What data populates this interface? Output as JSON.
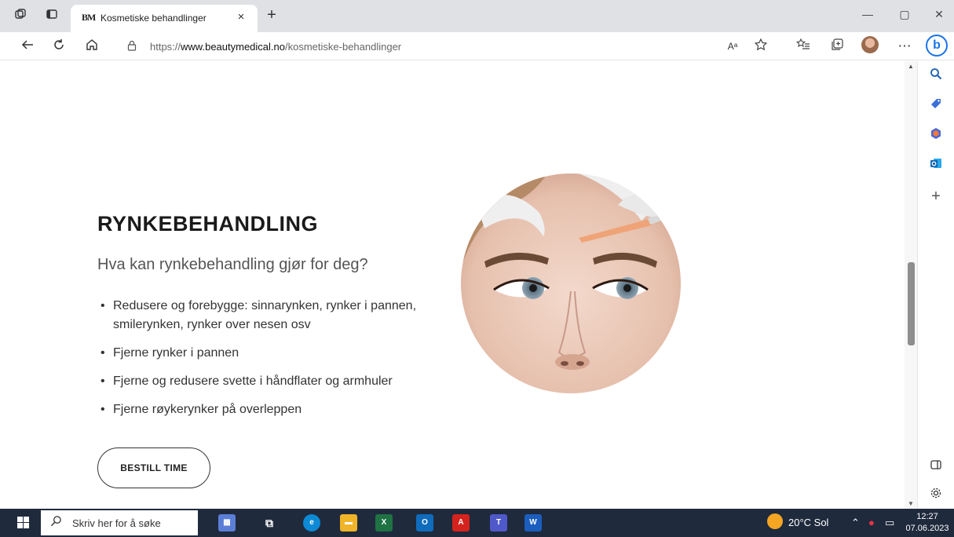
{
  "browser": {
    "tab": {
      "favicon_text": "BM",
      "title": "Kosmetiske behandlinger",
      "close_glyph": "×"
    },
    "new_tab_glyph": "+",
    "window_controls": {
      "minimize": "—",
      "restore": "▢",
      "close": "✕"
    },
    "url": {
      "prefix": "https://",
      "domain": "www.beautymedical.no",
      "path": "/kosmetiske-behandlinger"
    },
    "nav_icons": [
      "back-icon",
      "refresh-icon",
      "home-icon"
    ],
    "toolbar_icons": [
      "read-aloud-icon",
      "favorite-star-icon",
      "favorites-icon",
      "collections-icon",
      "profile-avatar",
      "more-icon",
      "bing-icon"
    ],
    "more_glyph": "⋯",
    "read_aloud_glyph": "Aᵃ"
  },
  "page": {
    "heading": "RYNKEBEHANDLING",
    "subheading": "Hva kan rynkebehandling gjør for deg?",
    "bullets": [
      "Redusere og forebygge: sinnarynken, rynker i pannen, smilerynken, rynker over nesen osv",
      "Fjerne rynker i pannen",
      "Fjerne og redusere svette i håndflater og armhuler",
      "Fjerne røykerynker på overleppen"
    ],
    "cta_label": "BESTILL TIME"
  },
  "sidebar": {
    "icons": [
      "search-icon",
      "tag-icon",
      "office-icon",
      "outlook-icon",
      "add-icon",
      "sidebar-panel-icon",
      "settings-icon"
    ]
  },
  "taskbar": {
    "search_placeholder": "Skriv her for å søke",
    "apps": [
      "calendar-icon",
      "task-view-icon",
      "edge-icon",
      "file-explorer-icon",
      "excel-icon",
      "outlook-icon",
      "acrobat-icon",
      "teams-icon",
      "word-icon"
    ],
    "weather": "20°C Sol",
    "time": "12:27",
    "date": "07.06.2023"
  },
  "colors": {
    "tab_strip": "#dfe1e5",
    "taskbar": "#1f2a3d",
    "edge_blue": "#1a73e8"
  }
}
